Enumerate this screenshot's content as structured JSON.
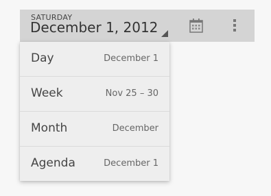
{
  "action_bar": {
    "weekday": "SATURDAY",
    "date": "December 1, 2012",
    "calendar_icon": "calendar-icon",
    "overflow_icon": "overflow-menu-icon"
  },
  "view_menu": {
    "items": [
      {
        "label": "Day",
        "detail": "December 1"
      },
      {
        "label": "Week",
        "detail": "Nov 25 – 30"
      },
      {
        "label": "Month",
        "detail": "December"
      },
      {
        "label": "Agenda",
        "detail": "December 1"
      }
    ]
  },
  "colors": {
    "action_bar_bg": "#d4d4d4",
    "menu_bg": "#eeeeee",
    "text": "#444444"
  }
}
